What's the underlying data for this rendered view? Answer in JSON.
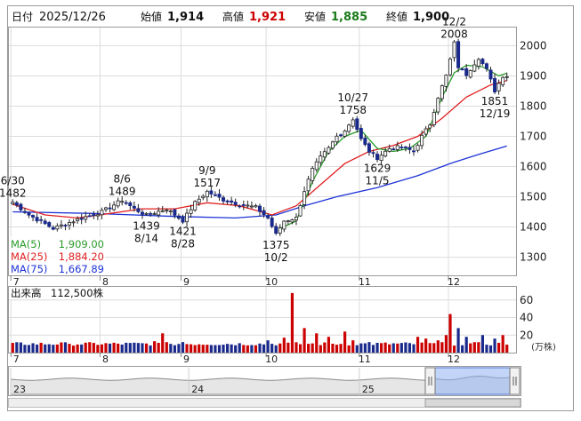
{
  "header": {
    "date_label": "日付",
    "date_value": "2025/12/26",
    "open_label": "始値",
    "open_value": "1,914",
    "high_label": "高値",
    "high_value": "1,921",
    "low_label": "安値",
    "low_value": "1,885",
    "close_label": "終値",
    "close_value": "1,900"
  },
  "colors": {
    "up": "#cc0000",
    "down": "#1a2a8c",
    "ma5": "#2a9a2a",
    "ma25": "#e02020",
    "ma75": "#1d33d6",
    "volume_up": "#cc0000",
    "volume_down": "#1a2a8c",
    "volume_bar_light": "#3b5bd0",
    "navigator_fill": "#8fb0f0"
  },
  "chart_data": [
    {
      "type": "candlestick",
      "title": "",
      "ylim": [
        1240,
        2060
      ],
      "y_ticks": [
        "1300",
        "1400",
        "1500",
        "1600",
        "1700",
        "1800",
        "1900",
        "2000"
      ],
      "y_tick_values": [
        1300,
        1400,
        1500,
        1600,
        1700,
        1800,
        1900,
        2000
      ],
      "x_month_labels": [
        "7",
        "8",
        "9",
        "10",
        "11",
        "12"
      ],
      "x_month_days": [
        0,
        22,
        42,
        63,
        86,
        108
      ],
      "num_days": 123,
      "legend": [
        {
          "name": "MA(5)",
          "value": "1,909.00"
        },
        {
          "name": "MA(25)",
          "value": "1,884.20"
        },
        {
          "name": "MA(75)",
          "value": "1,667.89"
        }
      ],
      "annotations": [
        {
          "date": "6/30",
          "value": "1482",
          "day": 0,
          "price": 1482,
          "position": "above"
        },
        {
          "date": "8/6",
          "value": "1489",
          "day": 27,
          "price": 1489,
          "position": "above"
        },
        {
          "date": "8/14",
          "value": "1439",
          "day": 33,
          "price": 1439,
          "position": "below"
        },
        {
          "date": "9/9",
          "value": "1517",
          "day": 48,
          "price": 1517,
          "position": "above"
        },
        {
          "date": "8/28",
          "value": "1421",
          "day": 42,
          "price": 1421,
          "position": "below"
        },
        {
          "date": "10/2",
          "value": "1375",
          "day": 65,
          "price": 1375,
          "position": "below"
        },
        {
          "date": "10/27",
          "value": "1758",
          "day": 84,
          "price": 1758,
          "position": "above"
        },
        {
          "date": "11/5",
          "value": "1629",
          "day": 90,
          "price": 1629,
          "position": "below"
        },
        {
          "date": "12/2",
          "value": "2008",
          "day": 109,
          "price": 2008,
          "position": "above"
        },
        {
          "date": "12/19",
          "value": "1851",
          "day": 119,
          "price": 1851,
          "position": "below"
        }
      ],
      "keypoints": [
        [
          0,
          1482
        ],
        [
          4,
          1440
        ],
        [
          10,
          1395
        ],
        [
          16,
          1425
        ],
        [
          22,
          1450
        ],
        [
          27,
          1489
        ],
        [
          30,
          1460
        ],
        [
          33,
          1439
        ],
        [
          38,
          1460
        ],
        [
          42,
          1421
        ],
        [
          45,
          1480
        ],
        [
          48,
          1517
        ],
        [
          52,
          1490
        ],
        [
          56,
          1475
        ],
        [
          60,
          1465
        ],
        [
          63,
          1430
        ],
        [
          65,
          1375
        ],
        [
          67,
          1420
        ],
        [
          70,
          1430
        ],
        [
          72,
          1520
        ],
        [
          74,
          1590
        ],
        [
          76,
          1630
        ],
        [
          78,
          1660
        ],
        [
          80,
          1700
        ],
        [
          82,
          1720
        ],
        [
          84,
          1758
        ],
        [
          86,
          1690
        ],
        [
          88,
          1650
        ],
        [
          90,
          1629
        ],
        [
          93,
          1660
        ],
        [
          96,
          1665
        ],
        [
          99,
          1650
        ],
        [
          101,
          1700
        ],
        [
          103,
          1740
        ],
        [
          105,
          1830
        ],
        [
          107,
          1900
        ],
        [
          109,
          2008
        ],
        [
          110,
          1930
        ],
        [
          112,
          1905
        ],
        [
          115,
          1960
        ],
        [
          117,
          1920
        ],
        [
          119,
          1851
        ],
        [
          121,
          1900
        ],
        [
          122,
          1900
        ]
      ],
      "ma_keypoints": {
        "ma5": [
          [
            66,
            1395
          ],
          [
            70,
            1420
          ],
          [
            74,
            1550
          ],
          [
            78,
            1650
          ],
          [
            82,
            1700
          ],
          [
            86,
            1720
          ],
          [
            90,
            1660
          ],
          [
            94,
            1650
          ],
          [
            98,
            1660
          ],
          [
            102,
            1700
          ],
          [
            106,
            1830
          ],
          [
            109,
            1910
          ],
          [
            112,
            1935
          ],
          [
            116,
            1930
          ],
          [
            120,
            1900
          ],
          [
            122,
            1909
          ]
        ],
        "ma25": [
          [
            0,
            1475
          ],
          [
            8,
            1440
          ],
          [
            16,
            1430
          ],
          [
            24,
            1445
          ],
          [
            32,
            1460
          ],
          [
            40,
            1460
          ],
          [
            48,
            1480
          ],
          [
            56,
            1470
          ],
          [
            64,
            1440
          ],
          [
            70,
            1470
          ],
          [
            76,
            1540
          ],
          [
            82,
            1610
          ],
          [
            88,
            1650
          ],
          [
            94,
            1670
          ],
          [
            100,
            1700
          ],
          [
            106,
            1760
          ],
          [
            112,
            1830
          ],
          [
            118,
            1870
          ],
          [
            122,
            1884.2
          ]
        ],
        "ma75": [
          [
            0,
            1450
          ],
          [
            20,
            1445
          ],
          [
            40,
            1435
          ],
          [
            55,
            1430
          ],
          [
            65,
            1440
          ],
          [
            72,
            1470
          ],
          [
            80,
            1500
          ],
          [
            90,
            1530
          ],
          [
            100,
            1570
          ],
          [
            108,
            1610
          ],
          [
            115,
            1640
          ],
          [
            122,
            1667.89
          ]
        ]
      }
    },
    {
      "type": "bar",
      "title": "出来高",
      "label_value": "112,500株",
      "unit": "(万株)",
      "ylim": [
        0,
        75
      ],
      "y_ticks": [
        "20",
        "40",
        "60"
      ],
      "y_tick_values": [
        20,
        40,
        60
      ],
      "spikes": [
        [
          14,
          10
        ],
        [
          35,
          13
        ],
        [
          37,
          22
        ],
        [
          39,
          10
        ],
        [
          42,
          12
        ],
        [
          63,
          14
        ],
        [
          67,
          17
        ],
        [
          69,
          68
        ],
        [
          72,
          28
        ],
        [
          75,
          22
        ],
        [
          78,
          18
        ],
        [
          82,
          24
        ],
        [
          84,
          14
        ],
        [
          88,
          12
        ],
        [
          100,
          18
        ],
        [
          102,
          16
        ],
        [
          105,
          14
        ],
        [
          107,
          20
        ],
        [
          108,
          44
        ],
        [
          110,
          28
        ],
        [
          112,
          18
        ],
        [
          116,
          20
        ],
        [
          119,
          16
        ],
        [
          121,
          20
        ]
      ],
      "baseline": 8
    },
    {
      "type": "area",
      "title": "",
      "tick_labels": [
        "23",
        "24",
        "25"
      ],
      "tick_fractions": [
        0.0,
        0.35,
        0.685
      ]
    }
  ]
}
